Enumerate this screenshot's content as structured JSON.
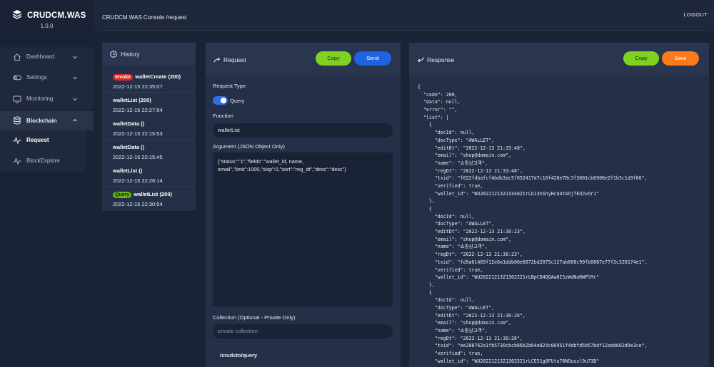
{
  "app": {
    "name": "CRUDCM.WAS",
    "version": "1.0.0"
  },
  "topbar": {
    "breadcrumb": "CRUDCM.WAS Console /request",
    "logout": "LOGOUT"
  },
  "sidebar": {
    "items": [
      {
        "label": "Dashboard",
        "icon": "home-icon"
      },
      {
        "label": "Settings",
        "icon": "toggle-icon"
      },
      {
        "label": "Monitoring",
        "icon": "monitor-icon"
      },
      {
        "label": "Blockchain",
        "icon": "database-icon"
      }
    ],
    "sub_items": [
      {
        "label": "Request",
        "icon": "pulse-icon"
      },
      {
        "label": "BlockExplore",
        "icon": "pulse-icon"
      }
    ]
  },
  "history": {
    "title": "History",
    "items": [
      {
        "badge": "Invoke",
        "badge_color": "#e02424",
        "title": "walletCreate (200)",
        "date": "2022-12-15 22:35:07"
      },
      {
        "badge": "",
        "title": "walletList (200)",
        "date": "2022-12-15 22:27:54"
      },
      {
        "badge": "",
        "title": "walletData ()",
        "date": "2022-12-15 22:15:53"
      },
      {
        "badge": "",
        "title": "walletData ()",
        "date": "2022-12-15 22:15:45"
      },
      {
        "badge": "",
        "title": "walletList ()",
        "date": "2022-12-15 22:26:14"
      },
      {
        "badge": "Query",
        "badge_color": "#6ab514",
        "title": "walletList (200)",
        "date": "2022-12-15 22:30:54"
      }
    ]
  },
  "request": {
    "title": "Request",
    "copy_label": "Copy",
    "send_label": "Send",
    "request_type_label": "Request Type",
    "toggle_label": "Query",
    "toggle_on": true,
    "function_label": "Function",
    "function_value": "walletList",
    "argument_label": "Argument (JSON Object Only)",
    "argument_value": "{\"status\":\"1\",\"fields\":\"wallet_id, name, email\",\"limit\":1000,\"skip\":0,\"sort\":\"reg_dt\",\"desc\":\"desc\"}",
    "collection_label": "Collection (Optional - Private Only)",
    "collection_placeholder": "private collection",
    "endpoint": "/crudsto/query"
  },
  "response": {
    "title": "Response",
    "copy_label": "Copy",
    "save_label": "Save",
    "lines": [
      "{",
      "  \"code\": 200,",
      "  \"data\": null,",
      "  \"error\": \"\",",
      "  \"list\": [",
      "    {",
      "      \"docId\": null,",
      "      \"docType\": \"AWALLET\",",
      "      \"editDt\": \"2022-12-13 21:33:48\",",
      "      \"email\": \"shop@domain.com\",",
      "      \"name\": \"쇼핑상고객\",",
      "      \"regDt\": \"2022-12-13 21:33:48\",",
      "      \"txid\": \"f022fdbafcf4bdb3ac5f852417d7c10f428e78c3f3001cb6906e2f1b3c1d9f86\",",
      "      \"verified\": true,",
      "      \"wallet_id\": \"WU202212132133482IrLb13nShyHcU4tAOjfEdJvOr1\"",
      "    },",
      "    {",
      "      \"docId\": null,",
      "      \"docType\": \"AWALLET\",",
      "      \"editDt\": \"2022-12-13 21:30:23\",",
      "      \"email\": \"shop@domain.com\",",
      "      \"name\": \"쇼핑상고객\",",
      "      \"regDt\": \"2022-12-13 21:30:23\",",
      "      \"txid\": \"fd9a61469f12e6a1ddb06e6872bd2075c127ab600c99fb0887e77f3c326174e1\",",
      "      \"verified\": true,",
      "      \"wallet_id\": \"WU2022121321302221rLBpC84QQAw6ISzWdNaRWPlMr\"",
      "    },",
      "    {",
      "      \"docId\": null,",
      "      \"docType\": \"AWALLET\",",
      "      \"editDt\": \"2022-12-13 21:30:26\",",
      "      \"email\": \"shop@domain.com\",",
      "      \"name\": \"쇼핑상고객\",",
      "      \"regDt\": \"2022-12-13 21:30:26\",",
      "      \"txid\": \"ee208762a1fb5730cbcb66b2b04e824c06951f4dbfd5b57bdf12add602d9e3ce\",",
      "      \"verified\": true,",
      "      \"wallet_id\": \"WU2022121321302521rLCE51g0FUtu70NOuszl9u73B\""
    ]
  },
  "colors": {
    "accent_green": "#7ed321",
    "accent_blue": "#1e63e0",
    "accent_orange": "#fb7b1a",
    "background": "#1a2235",
    "panel": "#243047"
  }
}
